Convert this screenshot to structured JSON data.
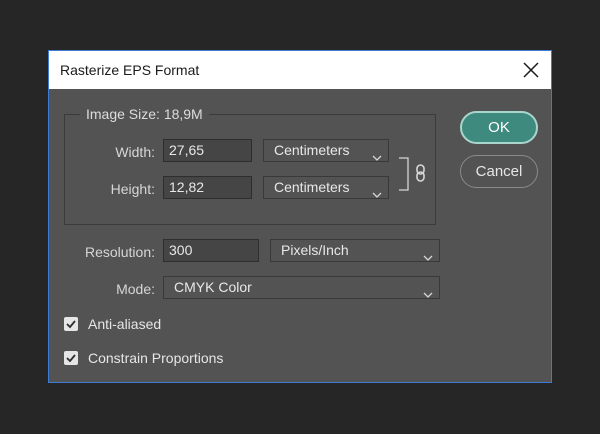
{
  "dialog": {
    "title": "Rasterize EPS Format"
  },
  "image_size": {
    "legend": "Image Size: 18,9M"
  },
  "width": {
    "label": "Width:",
    "value": "27,65",
    "unit": "Centimeters"
  },
  "height": {
    "label": "Height:",
    "value": "12,82",
    "unit": "Centimeters"
  },
  "resolution": {
    "label": "Resolution:",
    "value": "300",
    "unit": "Pixels/Inch"
  },
  "mode": {
    "label": "Mode:",
    "value": "CMYK Color"
  },
  "checkboxes": {
    "anti_aliased": {
      "label": "Anti-aliased",
      "checked": true
    },
    "constrain": {
      "label": "Constrain Proportions",
      "checked": true
    }
  },
  "buttons": {
    "ok": "OK",
    "cancel": "Cancel"
  },
  "colors": {
    "dialog_bg": "#535353",
    "ok_button": "#3f8a7f",
    "title_bar": "#ffffff",
    "focus_border": "#3d7bd6"
  }
}
